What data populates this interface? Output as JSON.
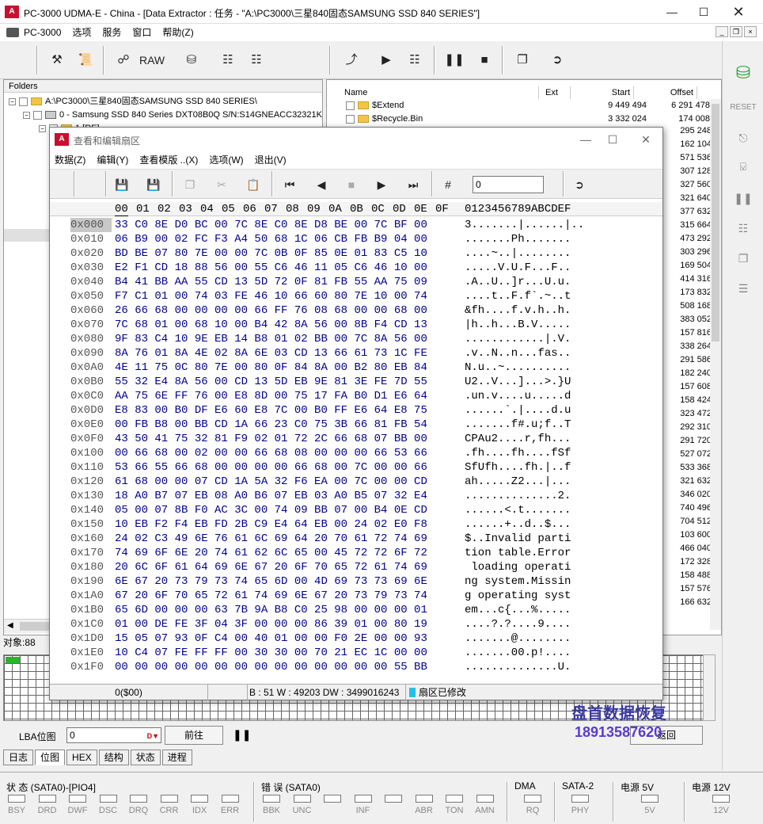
{
  "window": {
    "title": "PC-3000 UDMA-E - China - [Data Extractor : 任务 - \"A:\\PC3000\\三星840固态SAMSUNG SSD 840 SERIES\"]",
    "icon": "app-logo-icon"
  },
  "menubar": {
    "items": [
      "PC-3000",
      "选项",
      "服务",
      "窗口",
      "帮助(Z)"
    ]
  },
  "toolbar": {
    "raw_label": "RAW"
  },
  "folders": {
    "header": "Folders",
    "root": "A:\\PC3000\\三星840固态SAMSUNG SSD 840 SERIES\\",
    "disk": "0 - Samsung SSD 840 Series DXT08B0Q S/N:S14GNEACC32321K",
    "partition": "1 [RE]"
  },
  "filelist": {
    "columns": [
      "Name",
      "Ext",
      "Start",
      "Offset"
    ],
    "rows": [
      {
        "name": "$Extend",
        "ext": "",
        "start": "9 449 494",
        "offset": "6 291 478"
      },
      {
        "name": "$Recycle.Bin",
        "ext": "",
        "start": "3 332 024",
        "offset": "174 008"
      }
    ],
    "offsets_more": [
      "295 248",
      "162 104",
      "571 536",
      "307 128",
      "327 560",
      "321 640",
      "377 632",
      "315 664",
      "473 292",
      "303 296",
      "169 504",
      "414 316",
      "173 832",
      "508 168",
      "383 052",
      "157 816",
      "338 264",
      "291 586",
      "182 240",
      "157 608",
      "158 424",
      "323 472",
      "292 310",
      "291 720",
      "527 072",
      "533 368",
      "321 632",
      "346 020",
      "740 496",
      "704 512",
      "103 600",
      "466 040",
      "172 328",
      "158 488",
      "157 576",
      "166 632"
    ]
  },
  "objects_label": "对象:88",
  "lba": {
    "label": "LBA位图",
    "value": "0",
    "goto_label": "前往",
    "right_button": "返回"
  },
  "tabs": [
    "日志",
    "位图",
    "HEX",
    "结构",
    "状态",
    "进程"
  ],
  "status": {
    "group1_title": "状 态 (SATA0)-[PIO4]",
    "group1_leds": [
      "BSY",
      "DRD",
      "DWF",
      "DSC",
      "DRQ",
      "CRR",
      "IDX",
      "ERR"
    ],
    "group2_title": "错 误 (SATA0)",
    "group2_leds": [
      "BBK",
      "UNC",
      "",
      "INF",
      "",
      "ABR",
      "TON",
      "AMN"
    ],
    "dma_title": "DMA",
    "dma_leds": [
      "RQ"
    ],
    "sata_title": "SATA-2",
    "sata_leds": [
      "PHY"
    ],
    "p5_title": "电源 5V",
    "p5_leds": [
      "5V"
    ],
    "p12_title": "电源 12V",
    "p12_leds": [
      "12V"
    ]
  },
  "dialog": {
    "title": "查看和编辑扇区",
    "menu": [
      "数据(Z)",
      "编辑(Y)",
      "查看模版 ..(X)",
      "选项(W)",
      "退出(V)"
    ],
    "goto_value": "0",
    "hex_header_cols": [
      "00",
      "01",
      "02",
      "03",
      "04",
      "05",
      "06",
      "07",
      "08",
      "09",
      "0A",
      "0B",
      "0C",
      "0D",
      "0E",
      "0F"
    ],
    "ascii_header": "0123456789ABCDEF",
    "rows": [
      {
        "addr": "0x000",
        "hex": "33 C0 8E D0 BC 00 7C 8E C0 8E D8 BE 00 7C BF 00",
        "ascii": "3.......|......|.."
      },
      {
        "addr": "0x010",
        "hex": "06 B9 00 02 FC F3 A4 50 68 1C 06 CB FB B9 04 00",
        "ascii": ".......Ph......."
      },
      {
        "addr": "0x020",
        "hex": "BD BE 07 80 7E 00 00 7C 0B 0F 85 0E 01 83 C5 10",
        "ascii": "....~..|........"
      },
      {
        "addr": "0x030",
        "hex": "E2 F1 CD 18 88 56 00 55 C6 46 11 05 C6 46 10 00",
        "ascii": ".....V.U.F...F.."
      },
      {
        "addr": "0x040",
        "hex": "B4 41 BB AA 55 CD 13 5D 72 0F 81 FB 55 AA 75 09",
        "ascii": ".A..U..]r...U.u."
      },
      {
        "addr": "0x050",
        "hex": "F7 C1 01 00 74 03 FE 46 10 66 60 80 7E 10 00 74",
        "ascii": "....t..F.f`.~..t"
      },
      {
        "addr": "0x060",
        "hex": "26 66 68 00 00 00 00 66 FF 76 08 68 00 00 68 00",
        "ascii": "&fh....f.v.h..h."
      },
      {
        "addr": "0x070",
        "hex": "7C 68 01 00 68 10 00 B4 42 8A 56 00 8B F4 CD 13",
        "ascii": "|h..h...B.V....."
      },
      {
        "addr": "0x080",
        "hex": "9F 83 C4 10 9E EB 14 B8 01 02 BB 00 7C 8A 56 00",
        "ascii": "............|.V."
      },
      {
        "addr": "0x090",
        "hex": "8A 76 01 8A 4E 02 8A 6E 03 CD 13 66 61 73 1C FE",
        "ascii": ".v..N..n...fas.."
      },
      {
        "addr": "0x0A0",
        "hex": "4E 11 75 0C 80 7E 00 80 0F 84 8A 00 B2 80 EB 84",
        "ascii": "N.u..~.........."
      },
      {
        "addr": "0x0B0",
        "hex": "55 32 E4 8A 56 00 CD 13 5D EB 9E 81 3E FE 7D 55",
        "ascii": "U2..V...]...>.}U"
      },
      {
        "addr": "0x0C0",
        "hex": "AA 75 6E FF 76 00 E8 8D 00 75 17 FA B0 D1 E6 64",
        "ascii": ".un.v....u.....d"
      },
      {
        "addr": "0x0D0",
        "hex": "E8 83 00 B0 DF E6 60 E8 7C 00 B0 FF E6 64 E8 75",
        "ascii": "......`.|....d.u"
      },
      {
        "addr": "0x0E0",
        "hex": "00 FB B8 00 BB CD 1A 66 23 C0 75 3B 66 81 FB 54",
        "ascii": ".......f#.u;f..T"
      },
      {
        "addr": "0x0F0",
        "hex": "43 50 41 75 32 81 F9 02 01 72 2C 66 68 07 BB 00",
        "ascii": "CPAu2....r,fh..."
      },
      {
        "addr": "0x100",
        "hex": "00 66 68 00 02 00 00 66 68 08 00 00 00 66 53 66",
        "ascii": ".fh....fh....fSf"
      },
      {
        "addr": "0x110",
        "hex": "53 66 55 66 68 00 00 00 00 66 68 00 7C 00 00 66",
        "ascii": "SfUfh....fh.|..f"
      },
      {
        "addr": "0x120",
        "hex": "61 68 00 00 07 CD 1A 5A 32 F6 EA 00 7C 00 00 CD",
        "ascii": "ah.....Z2...|..."
      },
      {
        "addr": "0x130",
        "hex": "18 A0 B7 07 EB 08 A0 B6 07 EB 03 A0 B5 07 32 E4",
        "ascii": "..............2."
      },
      {
        "addr": "0x140",
        "hex": "05 00 07 8B F0 AC 3C 00 74 09 BB 07 00 B4 0E CD",
        "ascii": "......<.t......."
      },
      {
        "addr": "0x150",
        "hex": "10 EB F2 F4 EB FD 2B C9 E4 64 EB 00 24 02 E0 F8",
        "ascii": "......+..d..$..."
      },
      {
        "addr": "0x160",
        "hex": "24 02 C3 49 6E 76 61 6C 69 64 20 70 61 72 74 69",
        "ascii": "$..Invalid parti"
      },
      {
        "addr": "0x170",
        "hex": "74 69 6F 6E 20 74 61 62 6C 65 00 45 72 72 6F 72",
        "ascii": "tion table.Error"
      },
      {
        "addr": "0x180",
        "hex": "20 6C 6F 61 64 69 6E 67 20 6F 70 65 72 61 74 69",
        "ascii": " loading operati"
      },
      {
        "addr": "0x190",
        "hex": "6E 67 20 73 79 73 74 65 6D 00 4D 69 73 73 69 6E",
        "ascii": "ng system.Missin"
      },
      {
        "addr": "0x1A0",
        "hex": "67 20 6F 70 65 72 61 74 69 6E 67 20 73 79 73 74",
        "ascii": "g operating syst"
      },
      {
        "addr": "0x1B0",
        "hex": "65 6D 00 00 00 63 7B 9A B8 C0 25 98 00 00 00 01",
        "ascii": "em...c{...%....."
      },
      {
        "addr": "0x1C0",
        "hex": "01 00 DE FE 3F 04 3F 00 00 00 86 39 01 00 80 19",
        "ascii": "....?.?....9...."
      },
      {
        "addr": "0x1D0",
        "hex": "15 05 07 93 0F C4 00 40 01 00 00 F0 2E 00 00 93",
        "ascii": ".......@........"
      },
      {
        "addr": "0x1E0",
        "hex": "10 C4 07 FE FF FF 00 30 30 00 70 21 EC 1C 00 00",
        "ascii": ".......00.p!...."
      },
      {
        "addr": "0x1F0",
        "hex": "00 00 00 00 00 00 00 00 00 00 00 00 00 00 55 BB",
        "ascii": "..............U."
      }
    ],
    "status": {
      "pos": "0($00)",
      "info": "B : 51 W : 49203 DW : 3499016243",
      "modified": "扇区已修改"
    }
  },
  "watermark": {
    "line1": "盘首数据恢复",
    "line2": "18913587620"
  },
  "colors": {
    "hex_bytes": "#00008b",
    "accent": "#c8102e",
    "folder": "#f4c542"
  }
}
